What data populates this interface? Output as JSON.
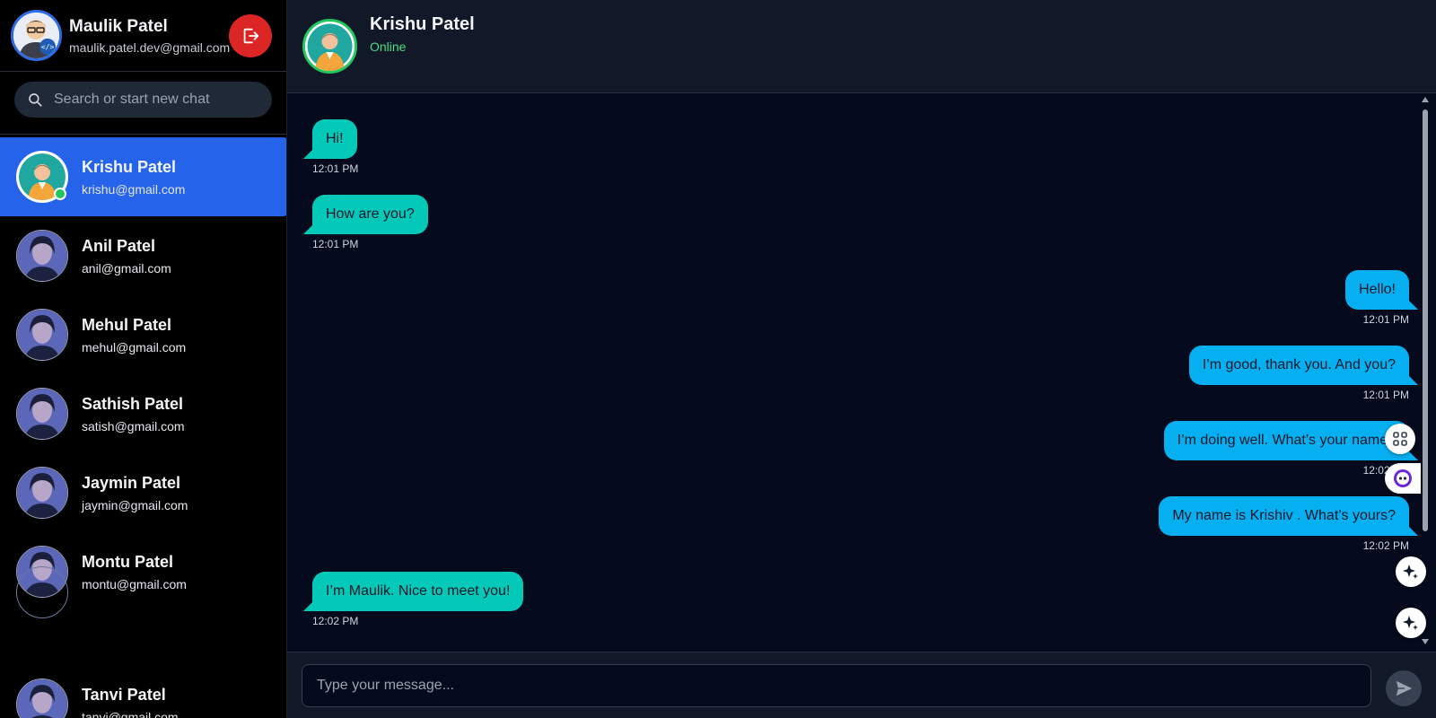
{
  "current_user": {
    "name": "Maulik Patel",
    "email": "maulik.patel.dev@gmail.com"
  },
  "search": {
    "placeholder": "Search or start new chat"
  },
  "contacts": [
    {
      "name": "Krishu Patel",
      "email": "krishu@gmail.com",
      "active": true,
      "online": true
    },
    {
      "name": "Anil Patel",
      "email": "anil@gmail.com"
    },
    {
      "name": "Mehul Patel",
      "email": "mehul@gmail.com"
    },
    {
      "name": "Sathish Patel",
      "email": "satish@gmail.com"
    },
    {
      "name": "Jaymin Patel",
      "email": "jaymin@gmail.com"
    },
    {
      "name": "Montu Patel",
      "email": "montu@gmail.com"
    },
    {
      "name": "Tanvi Patel",
      "email": "tanvi@gmail.com"
    }
  ],
  "chat": {
    "name": "Krishu Patel",
    "status": "Online",
    "messages": [
      {
        "direction": "in",
        "text": "Hi!",
        "time": "12:01 PM"
      },
      {
        "direction": "in",
        "text": "How are you?",
        "time": "12:01 PM"
      },
      {
        "direction": "out",
        "text": "Hello!",
        "time": "12:01 PM"
      },
      {
        "direction": "out",
        "text": "I’m good, thank you. And you?",
        "time": "12:01 PM"
      },
      {
        "direction": "out",
        "text": "I’m doing well. What’s your name?",
        "time": "12:02 PM"
      },
      {
        "direction": "out",
        "text": "My name is Krishiv . What’s yours?",
        "time": "12:02 PM"
      },
      {
        "direction": "in",
        "text": "I’m Maulik. Nice to meet you!",
        "time": "12:02 PM"
      }
    ]
  },
  "composer": {
    "placeholder": "Type your message..."
  },
  "colors": {
    "active_contact": "#2563eb",
    "incoming_bubble": "#05c9b8",
    "outgoing_bubble": "#06b0f0",
    "logout": "#dc2626",
    "online": "#22c55e"
  }
}
